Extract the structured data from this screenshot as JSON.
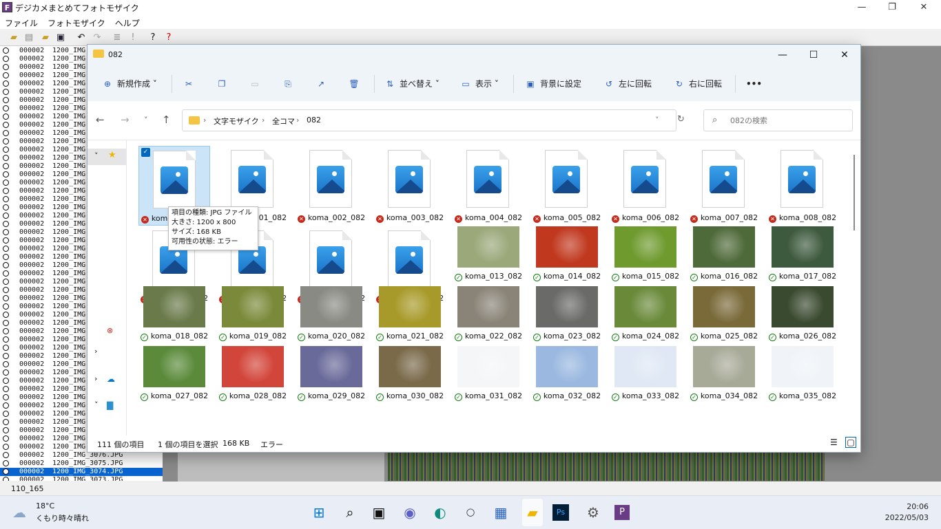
{
  "app": {
    "title": "デジカメまとめてフォトモザイク",
    "logo": "F",
    "menu": [
      "ファイル",
      "フォトモザイク",
      "ヘルプ"
    ],
    "window_controls": {
      "minimize": "—",
      "restore": "❐",
      "close": "✕"
    },
    "list": [
      {
        "a": "000002",
        "b": "1200_IMG"
      },
      {
        "a": "000002",
        "b": "1200_IMG"
      },
      {
        "a": "000002",
        "b": "1200_IMG"
      },
      {
        "a": "000002",
        "b": "1200_IMG"
      },
      {
        "a": "000002",
        "b": "1200_IMG"
      },
      {
        "a": "000002",
        "b": "1200_IMG"
      },
      {
        "a": "000002",
        "b": "1200_IMG"
      },
      {
        "a": "000002",
        "b": "1200_IMG"
      },
      {
        "a": "000002",
        "b": "1200_IMG"
      },
      {
        "a": "000002",
        "b": "1200_IMG"
      },
      {
        "a": "000002",
        "b": "1200_IMG"
      },
      {
        "a": "000002",
        "b": "1200_IMG"
      },
      {
        "a": "000002",
        "b": "1200_IMG"
      },
      {
        "a": "000002",
        "b": "1200_IMG"
      },
      {
        "a": "000002",
        "b": "1200_IMG"
      },
      {
        "a": "000002",
        "b": "1200_IMG"
      },
      {
        "a": "000002",
        "b": "1200_IMG"
      },
      {
        "a": "000002",
        "b": "1200_IMG"
      },
      {
        "a": "000002",
        "b": "1200_IMG"
      },
      {
        "a": "000002",
        "b": "1200_IMG"
      },
      {
        "a": "000002",
        "b": "1200_IMG"
      },
      {
        "a": "000002",
        "b": "1200_IMG"
      },
      {
        "a": "000002",
        "b": "1200_IMG"
      },
      {
        "a": "000002",
        "b": "1200_IMG"
      },
      {
        "a": "000002",
        "b": "1200_IMG"
      },
      {
        "a": "000002",
        "b": "1200_IMG"
      },
      {
        "a": "000002",
        "b": "1200_IMG"
      },
      {
        "a": "000002",
        "b": "1200_IMG"
      },
      {
        "a": "000002",
        "b": "1200_IMG"
      },
      {
        "a": "000002",
        "b": "1200_IMG"
      },
      {
        "a": "000002",
        "b": "1200_IMG"
      },
      {
        "a": "000002",
        "b": "1200_IMG"
      },
      {
        "a": "000002",
        "b": "1200_IMG"
      },
      {
        "a": "000002",
        "b": "1200_IMG"
      },
      {
        "a": "000002",
        "b": "1200_IMG"
      },
      {
        "a": "000002",
        "b": "1200_IMG"
      },
      {
        "a": "000002",
        "b": "1200_IMG"
      },
      {
        "a": "000002",
        "b": "1200_IMG"
      },
      {
        "a": "000002",
        "b": "1200_IMG"
      },
      {
        "a": "000002",
        "b": "1200_IMG"
      },
      {
        "a": "000002",
        "b": "1200_IMG"
      },
      {
        "a": "000002",
        "b": "1200_IMG"
      },
      {
        "a": "000002",
        "b": "1200_IMG"
      },
      {
        "a": "000002",
        "b": "1200_IMG"
      },
      {
        "a": "000002",
        "b": "1200_IMG"
      },
      {
        "a": "000002",
        "b": "1200_IMG"
      },
      {
        "a": "000002",
        "b": "1200_IMG"
      },
      {
        "a": "000002",
        "b": "1200_IMG"
      },
      {
        "a": "000002",
        "b": "1200_IMG"
      },
      {
        "a": "000002",
        "b": "1200_IMG_3076.JPG"
      },
      {
        "a": "000002",
        "b": "1200_IMG_3075.JPG"
      },
      {
        "a": "000002",
        "b": "1200_IMG_3074.JPG",
        "selected": true
      },
      {
        "a": "000002",
        "b": "1200_IMG_3073.JPG"
      }
    ],
    "status_count": "110_165"
  },
  "explorer": {
    "title": "082",
    "controls": {
      "minimize": "—",
      "maximize": "☐",
      "close": "✕"
    },
    "commands": {
      "new": "新規作成",
      "sort": "並べ替え",
      "view": "表示",
      "set_background": "背景に設定",
      "rotate_left": "左に回転",
      "rotate_right": "右に回転",
      "more": "•••"
    },
    "breadcrumb": [
      "文字モザイク",
      "全コマ",
      "082"
    ],
    "search_placeholder": "082の検索",
    "tooltip": [
      "項目の種類: JPG ファイル",
      "大きさ: 1200 x 800",
      "サイズ: 168 KB",
      "可用性の状態: エラー"
    ],
    "files": [
      {
        "name": "koma_000_082",
        "status": "error",
        "kind": "doc",
        "selected": true
      },
      {
        "name": "koma_001_082",
        "status": "error",
        "kind": "doc"
      },
      {
        "name": "koma_002_082",
        "status": "error",
        "kind": "doc"
      },
      {
        "name": "koma_003_082",
        "status": "error",
        "kind": "doc"
      },
      {
        "name": "koma_004_082",
        "status": "error",
        "kind": "doc"
      },
      {
        "name": "koma_005_082",
        "status": "error",
        "kind": "doc"
      },
      {
        "name": "koma_006_082",
        "status": "error",
        "kind": "doc"
      },
      {
        "name": "koma_007_082",
        "status": "error",
        "kind": "doc"
      },
      {
        "name": "koma_008_082",
        "status": "error",
        "kind": "doc"
      },
      {
        "name": "koma_009_082",
        "status": "error",
        "kind": "doc"
      },
      {
        "name": "koma_010_082",
        "status": "error",
        "kind": "doc"
      },
      {
        "name": "koma_011_082",
        "status": "error",
        "kind": "doc"
      },
      {
        "name": "koma_012_082",
        "status": "error",
        "kind": "doc"
      },
      {
        "name": "koma_013_082",
        "status": "ok",
        "kind": "photo",
        "color": "#9aa87a"
      },
      {
        "name": "koma_014_082",
        "status": "ok",
        "kind": "photo",
        "color": "#c0391f"
      },
      {
        "name": "koma_015_082",
        "status": "ok",
        "kind": "photo",
        "color": "#6e9a2e"
      },
      {
        "name": "koma_016_082",
        "status": "ok",
        "kind": "photo",
        "color": "#4f6a3a"
      },
      {
        "name": "koma_017_082",
        "status": "ok",
        "kind": "photo",
        "color": "#3e5a3e"
      },
      {
        "name": "koma_018_082",
        "status": "ok",
        "kind": "photo",
        "color": "#6a7a4a"
      },
      {
        "name": "koma_019_082",
        "status": "ok",
        "kind": "photo",
        "color": "#7a8a3a"
      },
      {
        "name": "koma_020_082",
        "status": "ok",
        "kind": "photo",
        "color": "#8a8a84"
      },
      {
        "name": "koma_021_082",
        "status": "ok",
        "kind": "photo",
        "color": "#a89a2a"
      },
      {
        "name": "koma_022_082",
        "status": "ok",
        "kind": "photo",
        "color": "#8a8478"
      },
      {
        "name": "koma_023_082",
        "status": "ok",
        "kind": "photo",
        "color": "#6a6a68"
      },
      {
        "name": "koma_024_082",
        "status": "ok",
        "kind": "photo",
        "color": "#6a8a3a"
      },
      {
        "name": "koma_025_082",
        "status": "ok",
        "kind": "photo",
        "color": "#7a6a3a"
      },
      {
        "name": "koma_026_082",
        "status": "ok",
        "kind": "photo",
        "color": "#3a4a30"
      },
      {
        "name": "koma_027_082",
        "status": "ok",
        "kind": "photo",
        "color": "#5a8a3a"
      },
      {
        "name": "koma_028_082",
        "status": "ok",
        "kind": "photo",
        "color": "#d2453a"
      },
      {
        "name": "koma_029_082",
        "status": "ok",
        "kind": "photo",
        "color": "#6a6a9a"
      },
      {
        "name": "koma_030_082",
        "status": "ok",
        "kind": "photo",
        "color": "#7a6a4a"
      },
      {
        "name": "koma_031_082",
        "status": "ok",
        "kind": "photo",
        "color": "#f4f6f8"
      },
      {
        "name": "koma_032_082",
        "status": "ok",
        "kind": "photo",
        "color": "#9ab8e0"
      },
      {
        "name": "koma_033_082",
        "status": "ok",
        "kind": "photo",
        "color": "#dfe8f4"
      },
      {
        "name": "koma_034_082",
        "status": "ok",
        "kind": "photo",
        "color": "#a8aa98"
      },
      {
        "name": "koma_035_082",
        "status": "ok",
        "kind": "photo",
        "color": "#f0f4f8"
      }
    ],
    "status": {
      "count": "111 個の項目",
      "selected": "1 個の項目を選択",
      "size": "168 KB",
      "state": "エラー"
    }
  },
  "taskbar": {
    "weather_temp": "18°C",
    "weather_desc": "くもり時々晴れ",
    "time": "20:06",
    "date": "2022/05/03"
  }
}
